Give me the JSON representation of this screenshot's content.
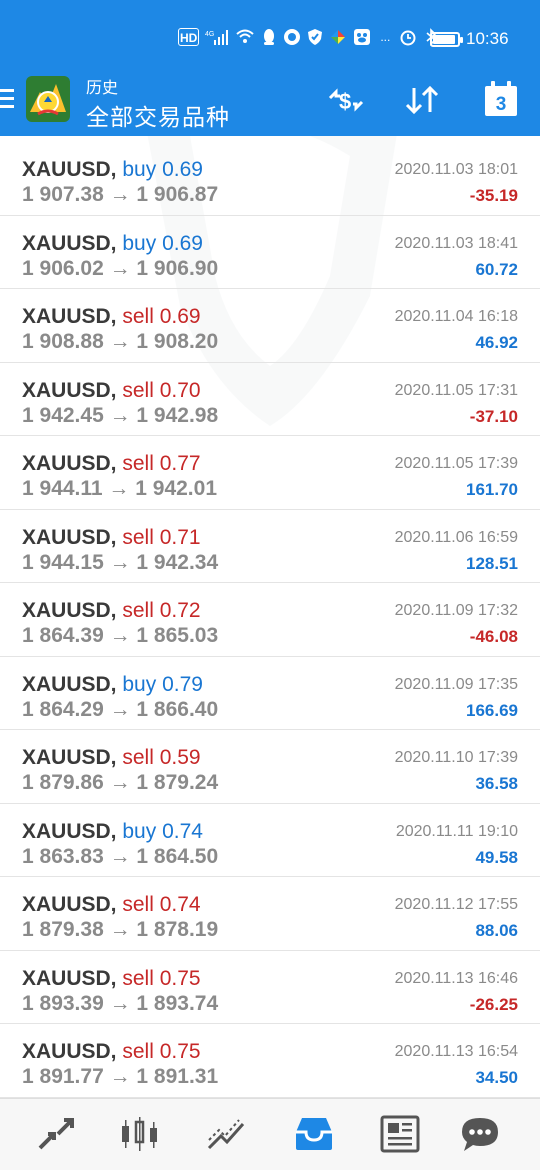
{
  "status_bar": {
    "indicators": [
      "HD",
      "4G",
      "signal",
      "wifi",
      "qq",
      "app",
      "shield",
      "colorful",
      "baidu",
      "..."
    ],
    "battery_level": 0.9,
    "time": "10:36"
  },
  "app_bar": {
    "subtitle": "历史",
    "title": "全部交易品种",
    "calendar_day": "3"
  },
  "trades": [
    {
      "symbol": "XAUUSD,",
      "side": "buy",
      "volume": "0.69",
      "prices": "1 907.38 → 1 906.87",
      "datetime": "2020.11.03 18:01",
      "profit": "-35.19"
    },
    {
      "symbol": "XAUUSD,",
      "side": "buy",
      "volume": "0.69",
      "prices": "1 906.02 → 1 906.90",
      "datetime": "2020.11.03 18:41",
      "profit": "60.72"
    },
    {
      "symbol": "XAUUSD,",
      "side": "sell",
      "volume": "0.69",
      "prices": "1 908.88 → 1 908.20",
      "datetime": "2020.11.04 16:18",
      "profit": "46.92"
    },
    {
      "symbol": "XAUUSD,",
      "side": "sell",
      "volume": "0.70",
      "prices": "1 942.45 → 1 942.98",
      "datetime": "2020.11.05 17:31",
      "profit": "-37.10"
    },
    {
      "symbol": "XAUUSD,",
      "side": "sell",
      "volume": "0.77",
      "prices": "1 944.11 → 1 942.01",
      "datetime": "2020.11.05 17:39",
      "profit": "161.70"
    },
    {
      "symbol": "XAUUSD,",
      "side": "sell",
      "volume": "0.71",
      "prices": "1 944.15 → 1 942.34",
      "datetime": "2020.11.06 16:59",
      "profit": "128.51"
    },
    {
      "symbol": "XAUUSD,",
      "side": "sell",
      "volume": "0.72",
      "prices": "1 864.39 → 1 865.03",
      "datetime": "2020.11.09 17:32",
      "profit": "-46.08"
    },
    {
      "symbol": "XAUUSD,",
      "side": "buy",
      "volume": "0.79",
      "prices": "1 864.29 → 1 866.40",
      "datetime": "2020.11.09 17:35",
      "profit": "166.69"
    },
    {
      "symbol": "XAUUSD,",
      "side": "sell",
      "volume": "0.59",
      "prices": "1 879.86 → 1 879.24",
      "datetime": "2020.11.10 17:39",
      "profit": "36.58"
    },
    {
      "symbol": "XAUUSD,",
      "side": "buy",
      "volume": "0.74",
      "prices": "1 863.83 → 1 864.50",
      "datetime": "2020.11.11 19:10",
      "profit": "49.58"
    },
    {
      "symbol": "XAUUSD,",
      "side": "sell",
      "volume": "0.74",
      "prices": "1 879.38 → 1 878.19",
      "datetime": "2020.11.12 17:55",
      "profit": "88.06"
    },
    {
      "symbol": "XAUUSD,",
      "side": "sell",
      "volume": "0.75",
      "prices": "1 893.39 → 1 893.74",
      "datetime": "2020.11.13 16:46",
      "profit": "-26.25"
    },
    {
      "symbol": "XAUUSD,",
      "side": "sell",
      "volume": "0.75",
      "prices": "1 891.77 → 1 891.31",
      "datetime": "2020.11.13 16:54",
      "profit": "34.50"
    }
  ],
  "bottom_nav": [
    {
      "icon": "quotes-icon",
      "active": false
    },
    {
      "icon": "chart-icon",
      "active": false
    },
    {
      "icon": "trade-icon",
      "active": false
    },
    {
      "icon": "history-icon",
      "active": true
    },
    {
      "icon": "news-icon",
      "active": false
    },
    {
      "icon": "chat-icon",
      "active": false
    }
  ],
  "colors": {
    "app_bar": "#1e88e5",
    "buy": "#1976d2",
    "sell": "#c62828",
    "profit_positive": "#1976d2",
    "profit_negative": "#c62828",
    "nav_active": "#1e88e5",
    "nav_inactive": "#555555"
  }
}
